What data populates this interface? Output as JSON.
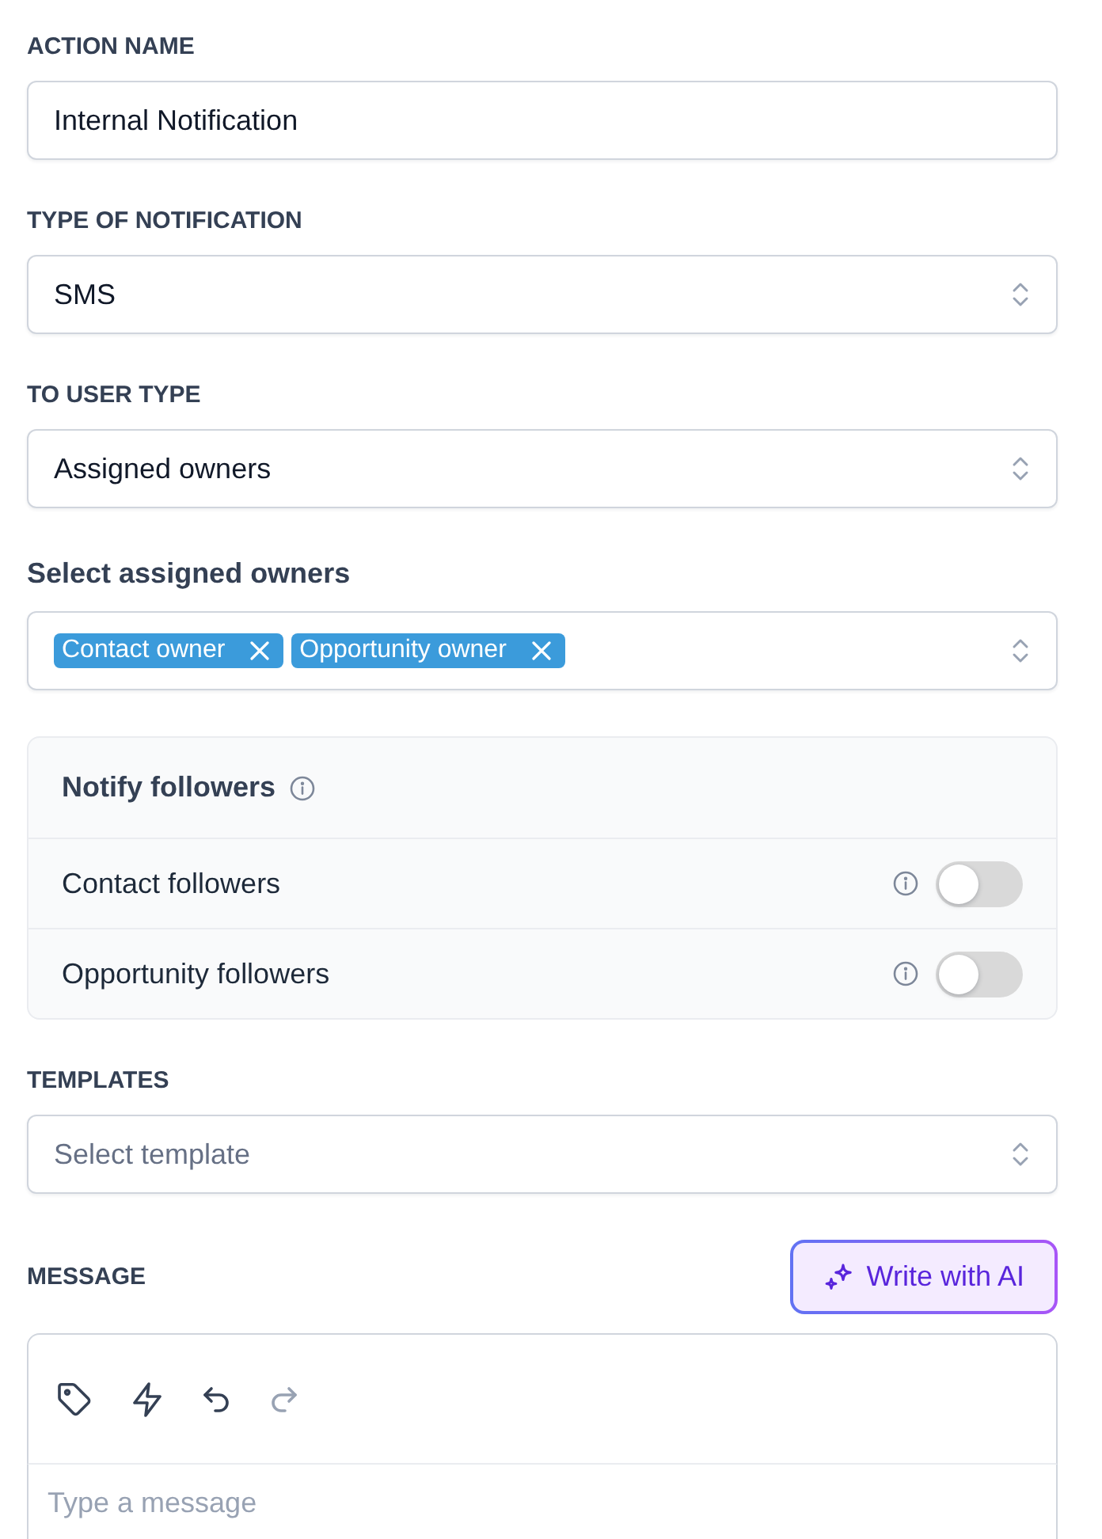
{
  "fields": [
    {
      "kind": "text",
      "label": "ACTION NAME",
      "value": "Internal Notification"
    },
    {
      "kind": "select",
      "label": "TYPE OF NOTIFICATION",
      "value": "SMS"
    },
    {
      "kind": "select",
      "label": "TO USER TYPE",
      "value": "Assigned owners"
    },
    {
      "kind": "multiselect",
      "label": "Select assigned owners",
      "tags": [
        "Contact owner",
        "Opportunity owner"
      ]
    }
  ],
  "followers": {
    "title": "Notify followers",
    "options": [
      {
        "label": "Contact followers",
        "on": false
      },
      {
        "label": "Opportunity followers",
        "on": false
      }
    ]
  },
  "templates": {
    "label": "TEMPLATES",
    "placeholder": "Select template"
  },
  "message": {
    "label": "MESSAGE",
    "ai_button": "Write with AI",
    "toolbar": [
      {
        "kind": "tag",
        "disabled": false
      },
      {
        "kind": "bolt",
        "disabled": false
      },
      {
        "kind": "undo",
        "disabled": false
      },
      {
        "kind": "redo",
        "disabled": true
      }
    ],
    "placeholder": "Type a message"
  }
}
